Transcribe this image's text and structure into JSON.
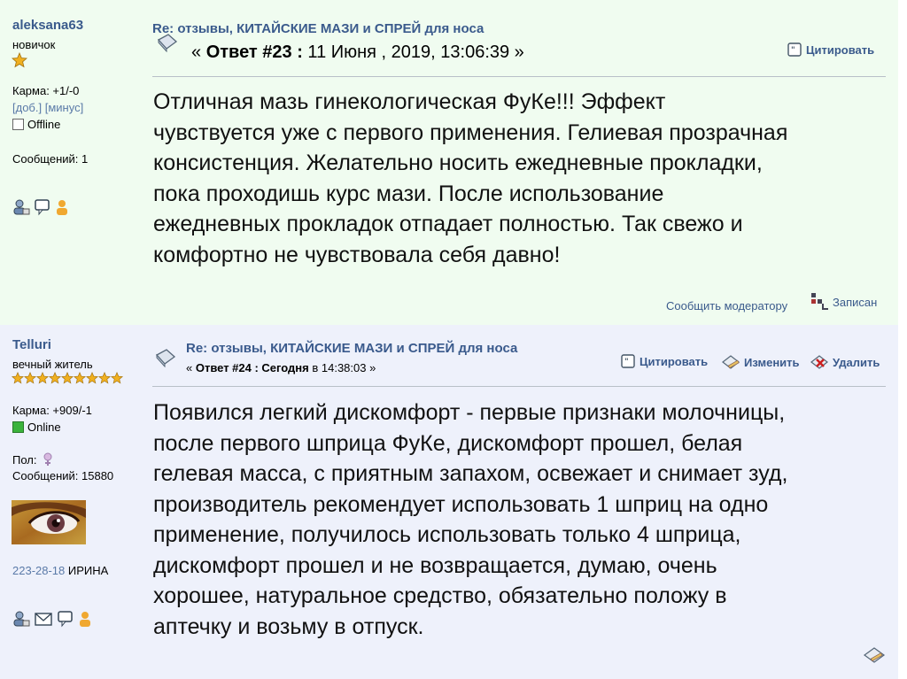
{
  "post1": {
    "author": {
      "name": "aleksana63",
      "rank": "новичок",
      "karma": "Карма: +1/-0",
      "karma_add": "[доб.]",
      "karma_minus": "[минус]",
      "status": "Offline",
      "messages": "Сообщений: 1",
      "stars": 1
    },
    "title": "Re: отзывы, КИТАЙСКИЕ МАЗИ и СПРЕЙ для носа",
    "reply_prefix": "« ",
    "reply_label": "Ответ #23 :",
    "reply_date": " 11 Июня , 2019, 13:06:39 »",
    "quote_label": "Цитировать",
    "body_lines": [
      "Отличная мазь гинекологическая ФуКе!!! Эффект",
      "чувствуется уже с первого применения. Гелиевая прозрачная",
      "консистенция. Желательно носить ежедневные прокладки,",
      "пока проходишь курс мази. После использование",
      "ежедневных прокладок отпадает полностью. Так свежо и",
      "комфортно не чувствовала себя давно!"
    ],
    "report_label": "Сообщить модератору",
    "logged_label": "Записан"
  },
  "post2": {
    "author": {
      "name": "Telluri",
      "rank": "вечный житель",
      "karma": "Карма: +909/-1",
      "status": "Online",
      "gender_label": "Пол:",
      "messages": "Сообщений: 15880",
      "signature_phone": "223-28-18",
      "signature_name": " ИРИНА",
      "stars": 9
    },
    "title": "Re: отзывы, КИТАЙСКИЕ МАЗИ и СПРЕЙ для носа",
    "reply_prefix": "« ",
    "reply_label": "Ответ #24 : Сегодня",
    "reply_date": " в 14:38:03 »",
    "quote_label": "Цитировать",
    "edit_label": "Изменить",
    "delete_label": "Удалить",
    "body_lines": [
      "Появился легкий дискомфорт - первые признаки молочницы,",
      "после первого шприца ФуКе, дискомфорт прошел, белая",
      "гелевая масса, с приятным запахом, освежает и снимает зуд,",
      "производитель рекомендует использовать 1 шприц на одно",
      "применение, получилось использовать только 4 шприца,",
      "дискомфорт прошел и не возвращается, думаю, очень",
      "хорошее, натуральное средство, обязательно положу в",
      "аптечку и возьму в отпуск."
    ]
  },
  "colors": {
    "post1_bg": "#f0fcf0",
    "post2_bg": "#eef1fb",
    "link": "#3a5a8c",
    "online": "#3bb33b",
    "star": "#f0b020"
  }
}
